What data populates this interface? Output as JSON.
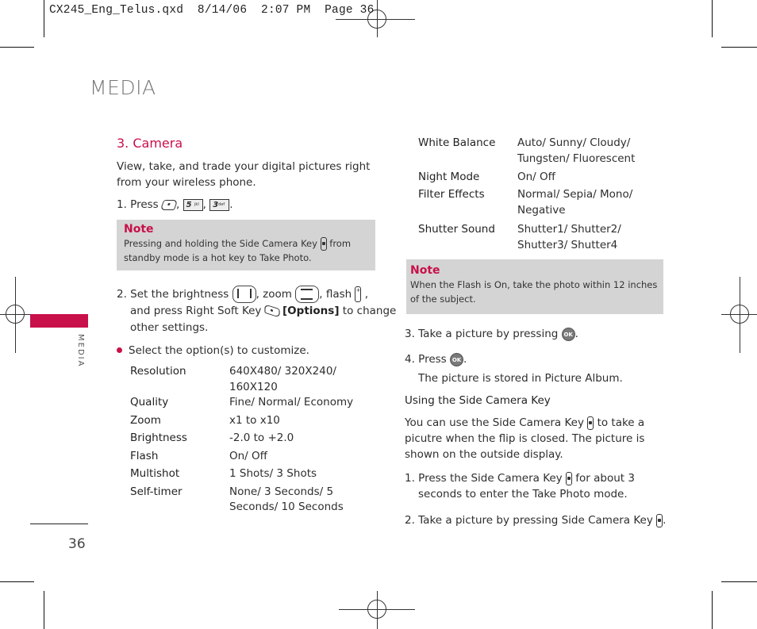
{
  "slug": "CX245_Eng_Telus.qxd  8/14/06  2:07 PM  Page 36",
  "page_title": "MEDIA",
  "side_tab_label": "MEDIA",
  "page_number": "36",
  "colors": {
    "accent": "#c8104a",
    "note_bg": "#d4d4d4",
    "title_gray": "#777777"
  },
  "left": {
    "section_title": "3. Camera",
    "intro": "View, take, and trade your digital pictures right from your wireless phone.",
    "step1": {
      "prefix": "1. Press",
      "keys": [
        "left-soft-key-icon",
        "5 jkl",
        "3 def"
      ],
      "sep": ",",
      "end": "."
    },
    "note": {
      "title": "Note",
      "text_before": "Pressing and holding the Side Camera Key",
      "text_after": "from standby mode is a hot key to Take Photo."
    },
    "step2": {
      "prefix": "2. Set the brightness",
      "zoom": ", zoom",
      "flash": ", flash",
      "comma": ",",
      "line2": "and press Right Soft Key",
      "options": "[Options]",
      "line2_end": "to change",
      "line3": "other settings."
    },
    "bullet": "Select the option(s) to customize.",
    "options": [
      {
        "key": "Resolution",
        "value": "640X480/ 320X240/ 160X120"
      },
      {
        "key": "Quality",
        "value": "Fine/ Normal/ Economy"
      },
      {
        "key": "Zoom",
        "value": "x1  to x10"
      },
      {
        "key": "Brightness",
        "value": "-2.0  to +2.0"
      },
      {
        "key": "Flash",
        "value": "On/ Off"
      },
      {
        "key": "Multishot",
        "value": "1 Shots/ 3 Shots"
      },
      {
        "key": "Self-timer",
        "value": "None/ 3 Seconds/ 5 Seconds/ 10 Seconds"
      }
    ]
  },
  "right": {
    "options": [
      {
        "key": "White Balance",
        "value": "Auto/ Sunny/ Cloudy/ Tungsten/ Fluorescent"
      },
      {
        "key": "Night Mode",
        "value": "On/ Off"
      },
      {
        "key": "Filter Effects",
        "value": "Normal/ Sepia/ Mono/ Negative"
      },
      {
        "key": "Shutter Sound",
        "value": "Shutter1/ Shutter2/ Shutter3/ Shutter4"
      }
    ],
    "note": {
      "title": "Note",
      "text": "When the Flash is On, take the photo within 12 inches of the subject."
    },
    "step3": "3. Take a picture by pressing",
    "step4": "4. Press",
    "step4_sub": "The picture is stored in Picture Album.",
    "ok_label": "OK",
    "period": ".",
    "subheading": "Using the Side Camera Key",
    "para_before": "You can use the Side Camera Key",
    "para_after": "to take a picutre when the flip is closed. The picture is shown on the outside display.",
    "list1_before": "1. Press the Side Camera Key",
    "list1_after": "for about 3",
    "list1_line2": "seconds to enter the Take Photo mode.",
    "list2": "2. Take a picture by pressing Side Camera Key"
  }
}
